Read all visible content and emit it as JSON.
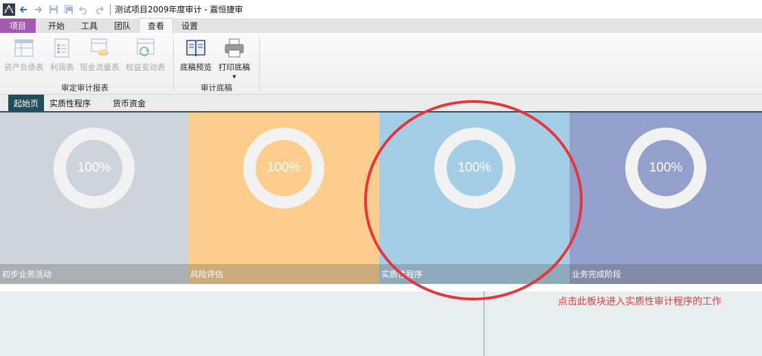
{
  "window": {
    "title": "测试项目2009年度审计 - 嘉恒捷审"
  },
  "quick_access": {
    "icons": [
      "back-icon",
      "forward-icon",
      "save-icon",
      "save-all-icon",
      "undo-icon",
      "redo-icon"
    ]
  },
  "ribbon_tabs": [
    "项目",
    "开始",
    "工具",
    "团队",
    "查看",
    "设置"
  ],
  "ribbon": {
    "groups": [
      {
        "label": "审定审计报表",
        "buttons": [
          {
            "label": "资产负债表",
            "enabled": false
          },
          {
            "label": "利润表",
            "enabled": false
          },
          {
            "label": "现金流量表",
            "enabled": false
          },
          {
            "label": "权益变动表",
            "enabled": false
          }
        ]
      },
      {
        "label": "审计底稿",
        "buttons": [
          {
            "label": "底稿预览",
            "enabled": true
          },
          {
            "label": "打印底稿",
            "enabled": true
          }
        ]
      }
    ]
  },
  "doc_tabs": [
    "起始页",
    "实质性程序",
    "货币资金"
  ],
  "tiles": [
    {
      "label": "初步业务活动",
      "progress": "100%",
      "color": "#cdd4db"
    },
    {
      "label": "风险评估",
      "progress": "100%",
      "color": "#fccd8c"
    },
    {
      "label": "实质性程序",
      "progress": "100%",
      "color": "#a4cde6"
    },
    {
      "label": "业务完成阶段",
      "progress": "100%",
      "color": "#94a0cc"
    }
  ],
  "annotation": {
    "text": "点击此板块进入实质性审计程序的工作",
    "color": "#e53d3d"
  }
}
